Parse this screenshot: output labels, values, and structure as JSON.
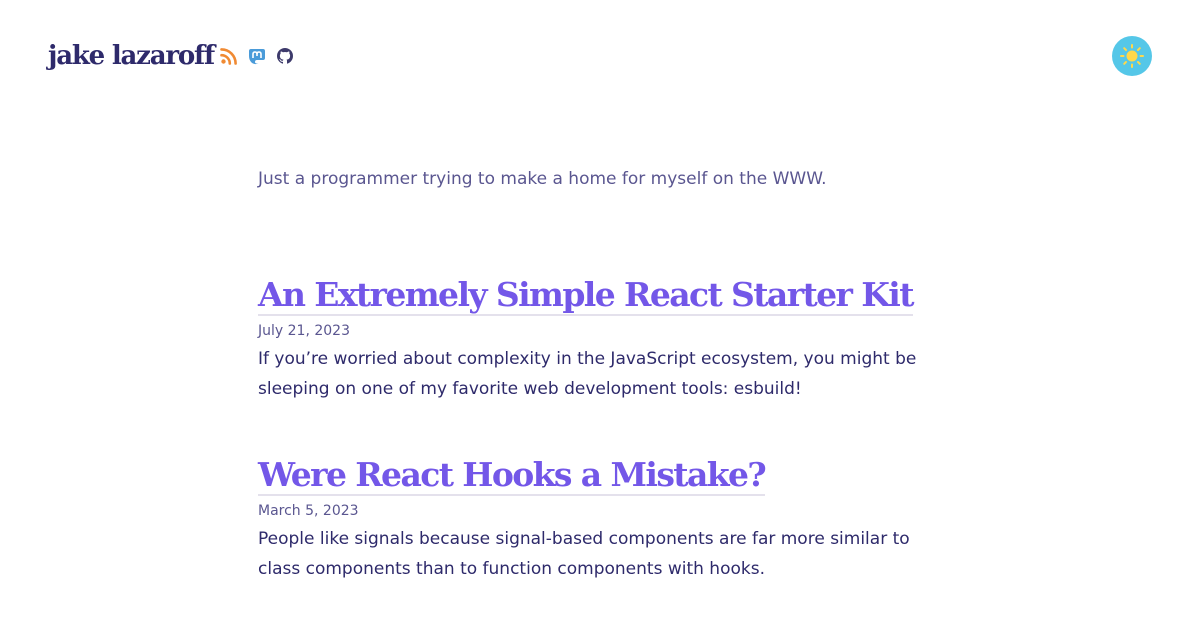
{
  "site": {
    "title": "jake lazaroff",
    "tagline": "Just a programmer trying to make a home for myself on the WWW."
  },
  "social": [
    {
      "name": "rss-icon",
      "color": "#f08a33"
    },
    {
      "name": "mastodon-icon",
      "color": "#4a9bd9"
    },
    {
      "name": "github-icon",
      "color": "#3d3a6b"
    }
  ],
  "theme_toggle": {
    "icon": "sun-icon",
    "background": "#55c7e8",
    "sun_color": "#ffd84a"
  },
  "posts": [
    {
      "title": "An Extremely Simple React Starter Kit",
      "date": "July 21, 2023",
      "summary": "If you’re worried about complexity in the JavaScript ecosystem, you might be sleeping on one of my favorite web development tools: esbuild!"
    },
    {
      "title": "Were React Hooks a Mistake?",
      "date": "March 5, 2023",
      "summary": "People like signals because signal-based components are far more similar to class components than to function components with hooks."
    }
  ],
  "colors": {
    "accent": "#7357e8",
    "text": "#2e2a6b",
    "muted": "#5a5690"
  }
}
